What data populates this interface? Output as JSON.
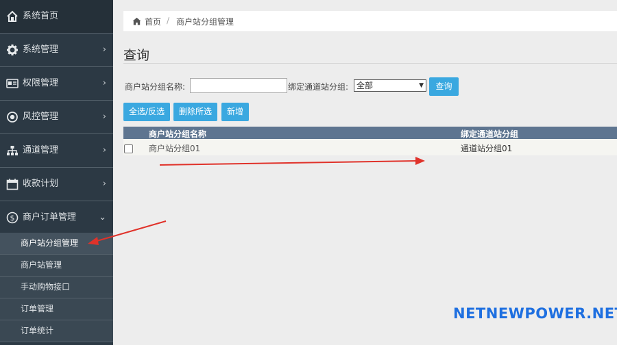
{
  "sidebar": {
    "home": {
      "label": "系统首页",
      "icon": "home-icon"
    },
    "items": [
      {
        "label": "系统管理",
        "icon": "gear-icon",
        "chevron": "›"
      },
      {
        "label": "权限管理",
        "icon": "id-card-icon",
        "chevron": "›"
      },
      {
        "label": "风控管理",
        "icon": "record-icon",
        "chevron": "›"
      },
      {
        "label": "通道管理",
        "icon": "sitemap-icon",
        "chevron": "›"
      },
      {
        "label": "收款计划",
        "icon": "calendar-icon",
        "chevron": "›"
      },
      {
        "label": "商户订单管理",
        "icon": "dollar-icon",
        "chevron": "⌄"
      }
    ],
    "submenu": [
      {
        "label": "商户站分组管理",
        "active": true
      },
      {
        "label": "商户站管理"
      },
      {
        "label": "手动购物接口"
      },
      {
        "label": "订单管理"
      },
      {
        "label": "订单统计"
      }
    ]
  },
  "breadcrumb": {
    "home": "首页",
    "sep": "/",
    "current": "商户站分组管理"
  },
  "page": {
    "title": "查询"
  },
  "search": {
    "name_label": "商户站分组名称:",
    "name_value": "",
    "group_label": "绑定通道站分组:",
    "group_selected": "全部",
    "query_button": "查询"
  },
  "actions": {
    "select_all": "全选/反选",
    "delete_selected": "删除所选",
    "add": "新增"
  },
  "table": {
    "headers": [
      "商户站分组名称",
      "绑定通道站分组"
    ],
    "rows": [
      [
        "商户站分组01",
        "通道站分组01"
      ]
    ]
  },
  "watermark": "NETNEWPOWER.NET",
  "colors": {
    "sidebar": "#2c3944",
    "button": "#3aa8e0",
    "table_header": "#5e7590",
    "arrow": "#e0322a",
    "watermark": "#1e6fe0"
  }
}
